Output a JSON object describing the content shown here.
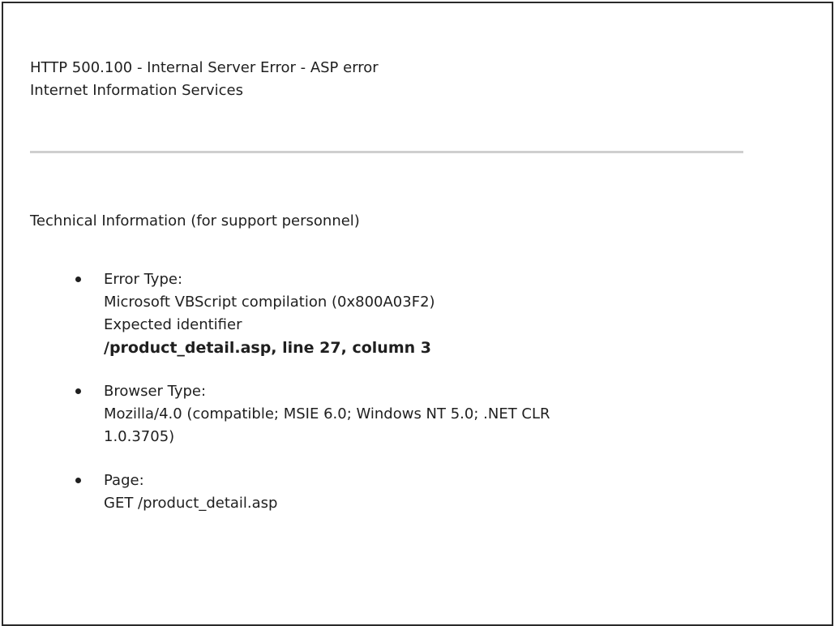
{
  "header": {
    "error_title": "HTTP 500.100 - Internal Server Error - ASP error",
    "server_name": "Internet Information Services"
  },
  "technical": {
    "heading": "Technical Information (for support personnel)",
    "items": [
      {
        "label": "Error Type:",
        "lines": [
          "Microsoft VBScript compilation (0x800A03F2)",
          "Expected identifier"
        ],
        "location": "/product_detail.asp, line 27, column 3"
      },
      {
        "label": "Browser Type:",
        "lines": [
          "Mozilla/4.0 (compatible; MSIE 6.0; Windows NT 5.0; .NET CLR",
          "1.0.3705)"
        ]
      },
      {
        "label": "Page:",
        "lines": [
          "GET /product_detail.asp"
        ]
      }
    ]
  }
}
